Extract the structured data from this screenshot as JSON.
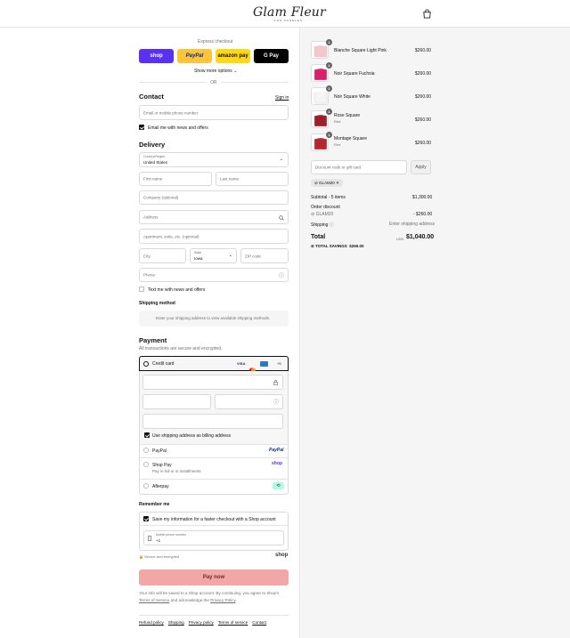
{
  "brand": {
    "name": "Glam Fleur",
    "tagline": "LOS ANGELES"
  },
  "express": {
    "title": "Express checkout",
    "buttons": [
      {
        "label": "shop",
        "bg": "#5a31f4",
        "fg": "#ffffff"
      },
      {
        "label": "PayPal",
        "bg": "#ffc439",
        "fg": "#003087"
      },
      {
        "label": "amazon pay",
        "bg": "#ffd814",
        "fg": "#111111"
      },
      {
        "label": "G Pay",
        "bg": "#000000",
        "fg": "#ffffff"
      }
    ],
    "more_options": "Show more options",
    "or": "OR"
  },
  "contact": {
    "title": "Contact",
    "signin": "Sign in",
    "email_placeholder": "Email or mobile phone number",
    "news_label": "Email me with news and offers"
  },
  "delivery": {
    "title": "Delivery",
    "country_label": "Country/Region",
    "country_value": "United States",
    "first_name": "First name",
    "last_name": "Last name",
    "company": "Company (optional)",
    "address": "Address",
    "apartment": "Apartment, suite, etc. (optional)",
    "city": "City",
    "state_label": "State",
    "state_value": "Iowa",
    "zip": "ZIP code",
    "phone": "Phone",
    "text_news": "Text me with news and offers"
  },
  "shipping_method": {
    "title": "Shipping method",
    "note": "Enter your shipping address to view available shipping methods."
  },
  "payment": {
    "title": "Payment",
    "subtitle": "All transactions are secure and encrypted.",
    "credit_card": "Credit card",
    "card_more": "+5",
    "billing_same": "Use shipping address as billing address",
    "paypal": "PayPal",
    "paypal_logo": "PayPal",
    "shop_pay": "Shop Pay",
    "shop_pay_sub": "Pay in full or in installments",
    "shop_logo": "shop",
    "afterpay": "Afterpay"
  },
  "remember": {
    "title": "Remember me",
    "save_label": "Save my information for a faster checkout with a Shop account",
    "mobile_label": "Mobile phone number",
    "mobile_value": "+1",
    "secure": "Secure and encrypted",
    "shop_logo": "shop"
  },
  "pay_now": "Pay now",
  "terms": {
    "line1": "Your info will be saved to a Shop account. By continuing, you agree to Shop's",
    "tos": "Terms of Service",
    "mid": "and acknowledge the",
    "privacy": "Privacy Policy",
    "end": "."
  },
  "footer_links": [
    "Refund policy",
    "Shipping",
    "Privacy policy",
    "Terms of service",
    "Contact"
  ],
  "cart": {
    "items": [
      {
        "name": "Blanche Square Light Pink",
        "variant": "",
        "price": "$260.00",
        "qty": "1",
        "color": "#f2c7cf"
      },
      {
        "name": "Noir Square Fuchsia",
        "variant": "",
        "price": "$260.00",
        "qty": "1",
        "color": "#d8216a"
      },
      {
        "name": "Noir Square White",
        "variant": "",
        "price": "$260.00",
        "qty": "1",
        "color": "#f4f4f4"
      },
      {
        "name": "Rose Square",
        "variant": "Red",
        "price": "$260.00",
        "qty": "1",
        "color": "#9c1f2b"
      },
      {
        "name": "Montage Square",
        "variant": "Red",
        "price": "$260.00",
        "qty": "1",
        "color": "#b3282d"
      }
    ],
    "discount_placeholder": "Discount code or gift card",
    "apply": "Apply",
    "code": "GLAM20",
    "subtotal_label": "Subtotal · 5 items",
    "subtotal": "$1,300.00",
    "order_discount": "Order discount",
    "discount_code": "GLAM20",
    "discount_amount": "- $260.00",
    "shipping_label": "Shipping",
    "shipping_value": "Enter shipping address",
    "total_label": "Total",
    "currency": "USD",
    "total": "$1,040.00",
    "savings_label": "TOTAL SAVINGS",
    "savings": "$260.00"
  }
}
